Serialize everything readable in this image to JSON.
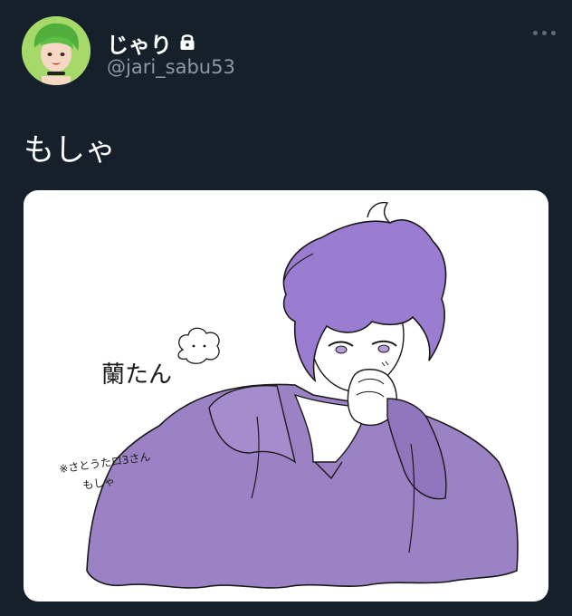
{
  "author": {
    "display_name": "じゃり",
    "handle": "@jari_sabu53",
    "protected_icon": "lock-icon",
    "avatar_icon": "avatar"
  },
  "tweet": {
    "text": "もしゃ"
  },
  "media": {
    "caption_main": "蘭たん",
    "caption_credit_line1": "※さとうたロ3さん",
    "caption_credit_line2": "もしゃ",
    "colors": {
      "hoodie": "#9b82c4",
      "hair": "#9a7dd0",
      "line": "#1a1a1a"
    }
  },
  "colors": {
    "background": "#15202b",
    "secondary_text": "#8b98a5",
    "avatar_bg": "#8fd14f"
  }
}
